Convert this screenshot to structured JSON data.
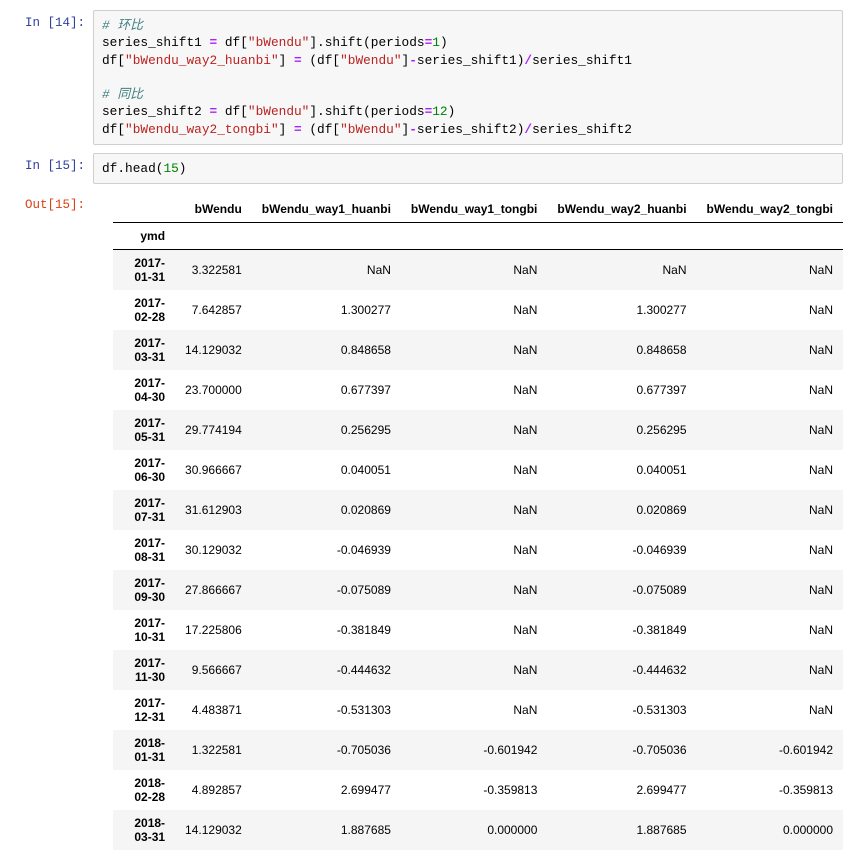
{
  "cells": {
    "c14": {
      "prompt": "In [14]:",
      "code_plain": "# 环比\nseries_shift1 = df[\"bWendu\"].shift(periods=1)\ndf[\"bWendu_way2_huanbi\"] = (df[\"bWendu\"]-series_shift1)/series_shift1\n\n# 同比\nseries_shift2 = df[\"bWendu\"].shift(periods=12)\ndf[\"bWendu_way2_tongbi\"] = (df[\"bWendu\"]-series_shift2)/series_shift2",
      "comment1": "# 环比",
      "comment2": "# 同比",
      "str_bWendu": "\"bWendu\"",
      "str_huanbi": "\"bWendu_way2_huanbi\"",
      "str_tongbi": "\"bWendu_way2_tongbi\"",
      "num1": "1",
      "num12": "12"
    },
    "c15": {
      "prompt": "In [15]:",
      "code_head": "df.head(",
      "code_15": "15",
      "code_close": ")",
      "out_prompt": "Out[15]:"
    }
  },
  "table": {
    "index_name": "ymd",
    "columns": [
      "bWendu",
      "bWendu_way1_huanbi",
      "bWendu_way1_tongbi",
      "bWendu_way2_huanbi",
      "bWendu_way2_tongbi"
    ],
    "rows": [
      {
        "ymd": "2017-01-31",
        "bWendu": "3.322581",
        "w1h": "NaN",
        "w1t": "NaN",
        "w2h": "NaN",
        "w2t": "NaN"
      },
      {
        "ymd": "2017-02-28",
        "bWendu": "7.642857",
        "w1h": "1.300277",
        "w1t": "NaN",
        "w2h": "1.300277",
        "w2t": "NaN"
      },
      {
        "ymd": "2017-03-31",
        "bWendu": "14.129032",
        "w1h": "0.848658",
        "w1t": "NaN",
        "w2h": "0.848658",
        "w2t": "NaN"
      },
      {
        "ymd": "2017-04-30",
        "bWendu": "23.700000",
        "w1h": "0.677397",
        "w1t": "NaN",
        "w2h": "0.677397",
        "w2t": "NaN"
      },
      {
        "ymd": "2017-05-31",
        "bWendu": "29.774194",
        "w1h": "0.256295",
        "w1t": "NaN",
        "w2h": "0.256295",
        "w2t": "NaN"
      },
      {
        "ymd": "2017-06-30",
        "bWendu": "30.966667",
        "w1h": "0.040051",
        "w1t": "NaN",
        "w2h": "0.040051",
        "w2t": "NaN"
      },
      {
        "ymd": "2017-07-31",
        "bWendu": "31.612903",
        "w1h": "0.020869",
        "w1t": "NaN",
        "w2h": "0.020869",
        "w2t": "NaN"
      },
      {
        "ymd": "2017-08-31",
        "bWendu": "30.129032",
        "w1h": "-0.046939",
        "w1t": "NaN",
        "w2h": "-0.046939",
        "w2t": "NaN"
      },
      {
        "ymd": "2017-09-30",
        "bWendu": "27.866667",
        "w1h": "-0.075089",
        "w1t": "NaN",
        "w2h": "-0.075089",
        "w2t": "NaN"
      },
      {
        "ymd": "2017-10-31",
        "bWendu": "17.225806",
        "w1h": "-0.381849",
        "w1t": "NaN",
        "w2h": "-0.381849",
        "w2t": "NaN"
      },
      {
        "ymd": "2017-11-30",
        "bWendu": "9.566667",
        "w1h": "-0.444632",
        "w1t": "NaN",
        "w2h": "-0.444632",
        "w2t": "NaN"
      },
      {
        "ymd": "2017-12-31",
        "bWendu": "4.483871",
        "w1h": "-0.531303",
        "w1t": "NaN",
        "w2h": "-0.531303",
        "w2t": "NaN"
      },
      {
        "ymd": "2018-01-31",
        "bWendu": "1.322581",
        "w1h": "-0.705036",
        "w1t": "-0.601942",
        "w2h": "-0.705036",
        "w2t": "-0.601942"
      },
      {
        "ymd": "2018-02-28",
        "bWendu": "4.892857",
        "w1h": "2.699477",
        "w1t": "-0.359813",
        "w2h": "2.699477",
        "w2t": "-0.359813"
      },
      {
        "ymd": "2018-03-31",
        "bWendu": "14.129032",
        "w1h": "1.887685",
        "w1t": "0.000000",
        "w2h": "1.887685",
        "w2t": "0.000000"
      }
    ]
  },
  "chart_data": {
    "type": "table",
    "index_name": "ymd",
    "columns": [
      "bWendu",
      "bWendu_way1_huanbi",
      "bWendu_way1_tongbi",
      "bWendu_way2_huanbi",
      "bWendu_way2_tongbi"
    ],
    "index": [
      "2017-01-31",
      "2017-02-28",
      "2017-03-31",
      "2017-04-30",
      "2017-05-31",
      "2017-06-30",
      "2017-07-31",
      "2017-08-31",
      "2017-09-30",
      "2017-10-31",
      "2017-11-30",
      "2017-12-31",
      "2018-01-31",
      "2018-02-28",
      "2018-03-31"
    ],
    "data": [
      [
        3.322581,
        null,
        null,
        null,
        null
      ],
      [
        7.642857,
        1.300277,
        null,
        1.300277,
        null
      ],
      [
        14.129032,
        0.848658,
        null,
        0.848658,
        null
      ],
      [
        23.7,
        0.677397,
        null,
        0.677397,
        null
      ],
      [
        29.774194,
        0.256295,
        null,
        0.256295,
        null
      ],
      [
        30.966667,
        0.040051,
        null,
        0.040051,
        null
      ],
      [
        31.612903,
        0.020869,
        null,
        0.020869,
        null
      ],
      [
        30.129032,
        -0.046939,
        null,
        -0.046939,
        null
      ],
      [
        27.866667,
        -0.075089,
        null,
        -0.075089,
        null
      ],
      [
        17.225806,
        -0.381849,
        null,
        -0.381849,
        null
      ],
      [
        9.566667,
        -0.444632,
        null,
        -0.444632,
        null
      ],
      [
        4.483871,
        -0.531303,
        null,
        -0.531303,
        null
      ],
      [
        1.322581,
        -0.705036,
        -0.601942,
        -0.705036,
        -0.601942
      ],
      [
        4.892857,
        2.699477,
        -0.359813,
        2.699477,
        -0.359813
      ],
      [
        14.129032,
        1.887685,
        0.0,
        1.887685,
        0.0
      ]
    ],
    "highlight_columns": [
      "bWendu_way2_huanbi",
      "bWendu_way2_tongbi"
    ]
  }
}
